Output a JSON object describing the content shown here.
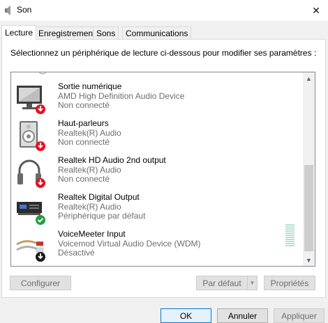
{
  "window": {
    "title": "Son",
    "close_glyph": "✕"
  },
  "tabs": [
    "Lecture",
    "Enregistrement",
    "Sons",
    "Communications"
  ],
  "instruction": "Sélectionnez un périphérique de lecture ci-dessous pour modifier ses paramètres :",
  "devices": [
    {
      "name": "Sortie numérique",
      "driver": "AMD High Definition Audio Device",
      "status": "Non connecté",
      "icon": "monitor-icon",
      "badge": "disconnected"
    },
    {
      "name": "Haut-parleurs",
      "driver": "Realtek(R) Audio",
      "status": "Non connecté",
      "icon": "speaker-icon",
      "badge": "disconnected"
    },
    {
      "name": "Realtek HD Audio 2nd output",
      "driver": "Realtek(R) Audio",
      "status": "Non connecté",
      "icon": "headphones-icon",
      "badge": "disconnected"
    },
    {
      "name": "Realtek Digital Output",
      "driver": "Realtek(R) Audio",
      "status": "Périphérique par défaut",
      "icon": "digital-output-icon",
      "badge": "default"
    },
    {
      "name": "VoiceMeeter Input",
      "driver": "Voicemod Virtual Audio Device (WDM)",
      "status": "Désactivé",
      "icon": "rca-cable-icon",
      "badge": "disabled"
    }
  ],
  "panel_buttons": {
    "configure": "Configurer",
    "default": "Par défaut",
    "properties": "Propriétés"
  },
  "dialog_buttons": {
    "ok": "OK",
    "cancel": "Annuler",
    "apply": "Appliquer"
  },
  "colors": {
    "accent": "#0078d7",
    "disconnected_badge": "#e81123",
    "default_badge": "#1f9e3a"
  }
}
